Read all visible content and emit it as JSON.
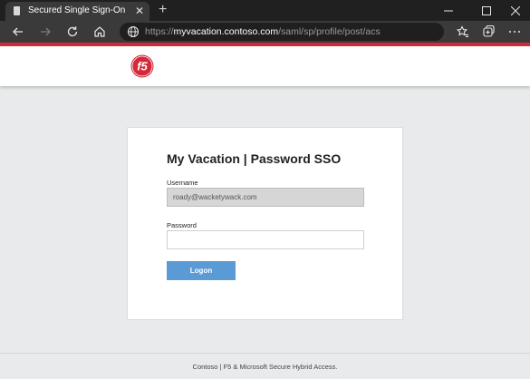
{
  "browser": {
    "tab_title": "Secured Single Sign-On",
    "tab_close": "✕",
    "new_tab": "+",
    "url": {
      "protocol": "https://",
      "host": "myvacation.contoso.com",
      "path": "/saml/sp/profile/post/acs"
    },
    "icons": [
      "back-icon",
      "forward-icon",
      "refresh-icon",
      "home-icon",
      "globe-icon",
      "favorites-icon",
      "collections-icon",
      "minimize-icon",
      "maximize-icon",
      "close-icon"
    ]
  },
  "header": {
    "logo_text": "f5",
    "accent_color": "#d3293a"
  },
  "login": {
    "title": "My Vacation | Password SSO",
    "username_label": "Username",
    "username_value": "roady@wacketywack.com",
    "password_label": "Password",
    "password_value": "",
    "login_button": "Logon",
    "button_color": "#5b9bd5"
  },
  "footer": {
    "text": "Contoso | F5 & Microsoft Secure Hybrid Access."
  }
}
